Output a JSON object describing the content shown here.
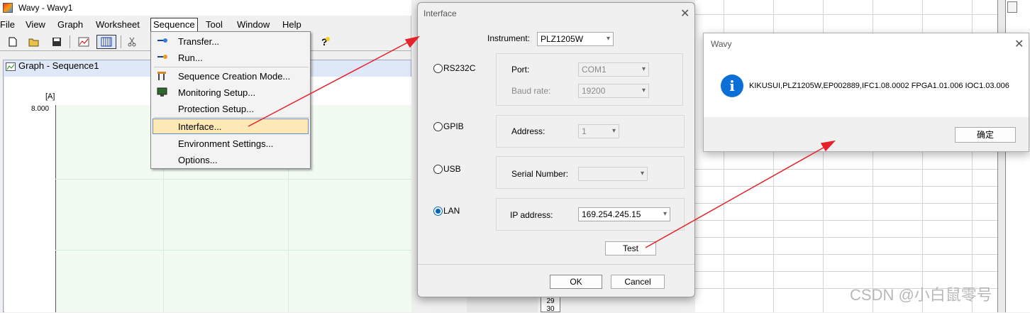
{
  "window": {
    "title": "Wavy - Wavy1"
  },
  "menubar": {
    "file": "File",
    "view": "View",
    "graph": "Graph",
    "worksheet": "Worksheet",
    "sequence": "Sequence",
    "tool": "Tool",
    "window": "Window",
    "help": "Help"
  },
  "toolbar": {
    "new": "new-file-icon",
    "open": "open-folder-icon",
    "save": "save-icon",
    "graph": "graph-icon",
    "worksheet": "worksheet-icon",
    "cut": "cut-icon",
    "help": "help-icon"
  },
  "graph_window": {
    "title": "Graph - Sequence1",
    "unit": "[A]",
    "y_max": "8.000"
  },
  "sequence_menu": {
    "items": [
      {
        "label": "Transfer...",
        "icon": "transfer-icon"
      },
      {
        "label": "Run...",
        "icon": "run-icon"
      },
      {
        "label": "Sequence Creation Mode...",
        "icon": "tools-icon"
      },
      {
        "label": "Monitoring Setup...",
        "icon": "monitor-icon"
      },
      {
        "label": "Protection Setup...",
        "icon": ""
      },
      {
        "label": "Interface...",
        "icon": "",
        "highlighted": true
      },
      {
        "label": "Environment Settings...",
        "icon": ""
      },
      {
        "label": "Options...",
        "icon": ""
      }
    ]
  },
  "interface_dialog": {
    "title": "Interface",
    "instrument_label": "Instrument:",
    "instrument_value": "PLZ1205W",
    "rs232c": {
      "label": "RS232C",
      "port_label": "Port:",
      "port_value": "COM1",
      "baud_label": "Baud rate:",
      "baud_value": "19200"
    },
    "gpib": {
      "label": "GPIB",
      "address_label": "Address:",
      "address_value": "1"
    },
    "usb": {
      "label": "USB",
      "serial_label": "Serial Number:",
      "serial_value": ""
    },
    "lan": {
      "label": "LAN",
      "ip_label": "IP address:",
      "ip_value": "169.254.245.15",
      "selected": true
    },
    "test_button": "Test",
    "ok_button": "OK",
    "cancel_button": "Cancel"
  },
  "message_box": {
    "title": "Wavy",
    "message": "KIKUSUI,PLZ1205W,EP002889,IFC1.08.0002 FPGA1.01.006 IOC1.03.006",
    "ok_button": "确定"
  },
  "worksheet": {
    "row_29": "29",
    "row_30": "30"
  },
  "watermark": "CSDN @小白鼠零号",
  "colors": {
    "arrow": "#e8202a",
    "menu_highlight": "#fde9b6",
    "info_icon": "#0a70d8",
    "plot_bg": "#f2fbf2"
  }
}
